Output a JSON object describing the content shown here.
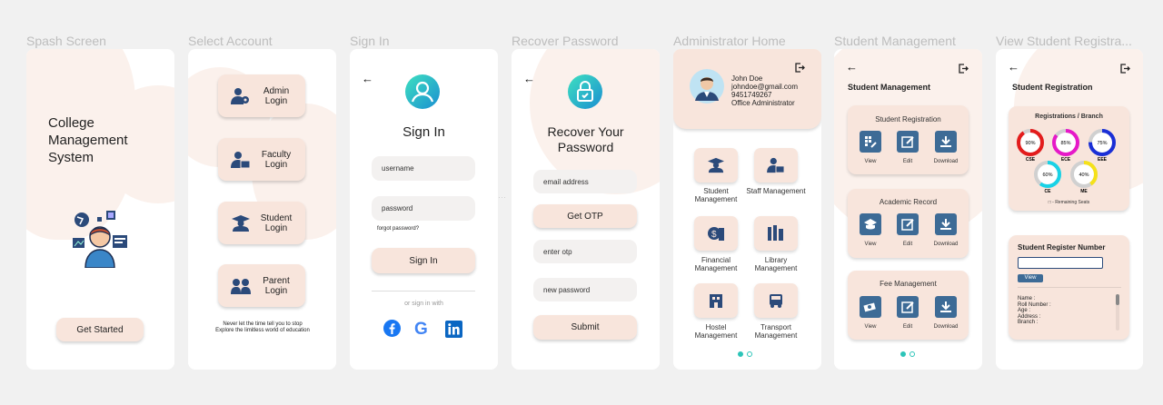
{
  "titles": [
    "Spash Screen",
    "Select Account",
    "Sign In",
    "Recover Password",
    "Administrator Home",
    "Student Management",
    "View Student Registra..."
  ],
  "splash": {
    "app_name": "College Management System",
    "cta": "Get Started",
    "icon": "student-avatar-icon"
  },
  "select_account": {
    "buttons": [
      {
        "label": "Admin Login",
        "icon": "admin-icon"
      },
      {
        "label": "Faculty Login",
        "icon": "faculty-icon"
      },
      {
        "label": "Student Login",
        "icon": "graduate-icon"
      },
      {
        "label": "Parent Login",
        "icon": "parent-icon"
      }
    ],
    "quote": "Never let the time tell you to stop Explore the limitless world of education"
  },
  "sign_in": {
    "heading": "Sign In",
    "username_placeholder": "username",
    "password_placeholder": "password",
    "forgot": "forgot password?",
    "submit": "Sign In",
    "alt": "or sign in with",
    "social": [
      "facebook-icon",
      "google-icon",
      "linkedin-icon"
    ]
  },
  "recover": {
    "heading": "Recover Your Password",
    "email_placeholder": "email address",
    "get_otp": "Get OTP",
    "otp_placeholder": "enter otp",
    "new_password_placeholder": "new password",
    "submit": "Submit"
  },
  "admin_home": {
    "name": "John Doe",
    "email": "johndoe@gmail.com",
    "phone": "9451749267",
    "role": "Office Administrator",
    "tiles": [
      {
        "label": "Student Management",
        "icon": "student-icon"
      },
      {
        "label": "Staff Management",
        "icon": "staff-icon"
      },
      {
        "label": "Financial Management",
        "icon": "finance-icon"
      },
      {
        "label": "Library Management",
        "icon": "library-icon"
      },
      {
        "label": "Hostel Management",
        "icon": "hostel-icon"
      },
      {
        "label": "Transport Management",
        "icon": "bus-icon"
      }
    ]
  },
  "student_mgmt": {
    "heading": "Student Management",
    "sections": [
      {
        "title": "Student Registration",
        "actions": [
          "View",
          "Edit",
          "Download"
        ]
      },
      {
        "title": "Academic Record",
        "actions": [
          "View",
          "Edit",
          "Download"
        ]
      },
      {
        "title": "Fee Management",
        "actions": [
          "View",
          "Edit",
          "Download"
        ]
      }
    ]
  },
  "view_reg": {
    "heading": "Student Registration",
    "chart_title": "Registrations / Branch",
    "legend": "- Remaining Seats",
    "register_title": "Student Register Number",
    "view_btn": "View",
    "fields": [
      "Name :",
      "Roll Number :",
      "Age :",
      "Address :",
      "Branch :"
    ]
  },
  "chart_data": {
    "type": "pie",
    "title": "Registrations / Branch",
    "categories": [
      "CSE",
      "ECE",
      "EEE",
      "CE",
      "ME"
    ],
    "values": [
      90,
      85,
      75,
      60,
      40
    ],
    "colors": [
      "#e31c1c",
      "#e619c8",
      "#1a2fd6",
      "#19d2e6",
      "#f5e11a"
    ],
    "remaining_color": "#d0d0d0"
  },
  "colors": {
    "accent": "#f8e5dc",
    "teal": "#2cc4b8",
    "navy": "#2b4a7a"
  }
}
